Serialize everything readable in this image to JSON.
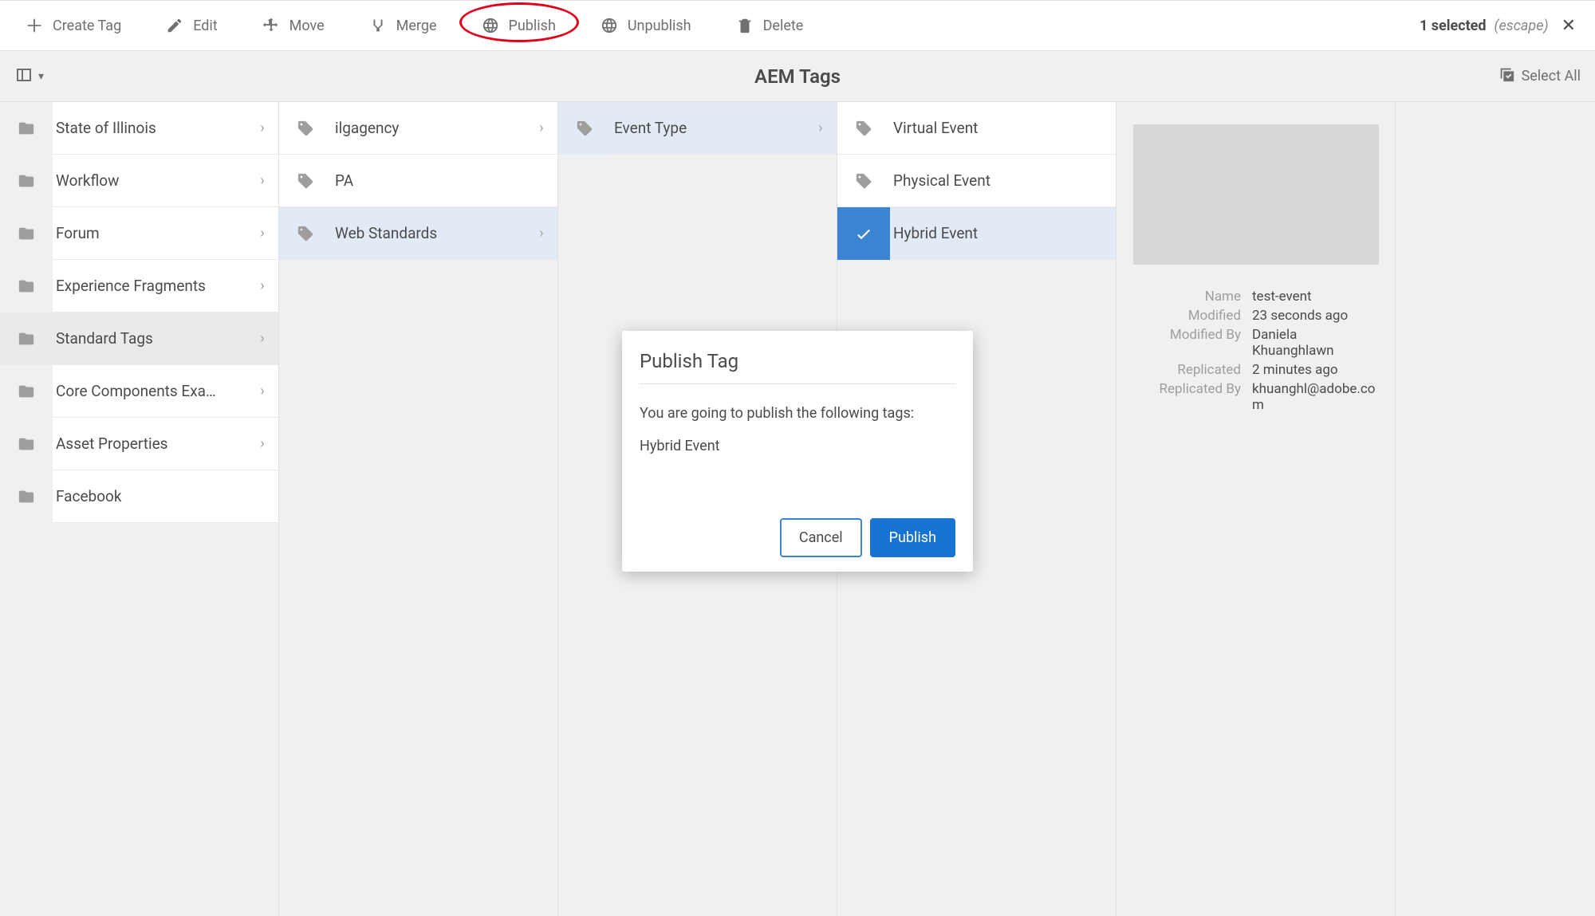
{
  "toolbar": {
    "create_tag": "Create Tag",
    "edit": "Edit",
    "move": "Move",
    "merge": "Merge",
    "publish": "Publish",
    "unpublish": "Unpublish",
    "delete": "Delete",
    "selection_count": "1 selected",
    "escape_hint": "(escape)"
  },
  "subbar": {
    "page_title": "AEM Tags",
    "select_all": "Select All"
  },
  "columns": [
    {
      "items": [
        {
          "label": "State of Illinois",
          "has_children": true,
          "icon": "folder"
        },
        {
          "label": "Workflow",
          "has_children": true,
          "icon": "folder"
        },
        {
          "label": "Forum",
          "has_children": true,
          "icon": "folder"
        },
        {
          "label": "Experience Fragments",
          "has_children": true,
          "icon": "folder"
        },
        {
          "label": "Standard Tags",
          "has_children": true,
          "icon": "folder",
          "active_path": true
        },
        {
          "label": "Core Components Exa…",
          "has_children": true,
          "icon": "folder"
        },
        {
          "label": "Asset Properties",
          "has_children": true,
          "icon": "folder"
        },
        {
          "label": "Facebook",
          "has_children": false,
          "icon": "folder"
        }
      ]
    },
    {
      "items": [
        {
          "label": "ilgagency",
          "has_children": true,
          "icon": "tag"
        },
        {
          "label": "PA",
          "has_children": false,
          "icon": "tag"
        },
        {
          "label": "Web Standards",
          "has_children": true,
          "icon": "tag",
          "active_path": true
        }
      ]
    },
    {
      "items": [
        {
          "label": "Event Type",
          "has_children": true,
          "icon": "tag",
          "active_path": true
        }
      ]
    },
    {
      "items": [
        {
          "label": "Virtual Event",
          "has_children": false,
          "icon": "tag"
        },
        {
          "label": "Physical Event",
          "has_children": false,
          "icon": "tag"
        },
        {
          "label": "Hybrid Event",
          "has_children": false,
          "icon": "check",
          "selected": true
        }
      ]
    }
  ],
  "detail": {
    "fields": [
      {
        "label": "Name",
        "value": "test-event"
      },
      {
        "label": "Modified",
        "value": "23 seconds ago"
      },
      {
        "label": "Modified By",
        "value": "Daniela Khuanghlawn"
      },
      {
        "label": "Replicated",
        "value": "2 minutes ago"
      },
      {
        "label": "Replicated By",
        "value": "khuanghl@adobe.com"
      }
    ]
  },
  "dialog": {
    "title": "Publish Tag",
    "message": "You are going to publish the following tags:",
    "tag": "Hybrid Event",
    "cancel": "Cancel",
    "publish": "Publish"
  }
}
